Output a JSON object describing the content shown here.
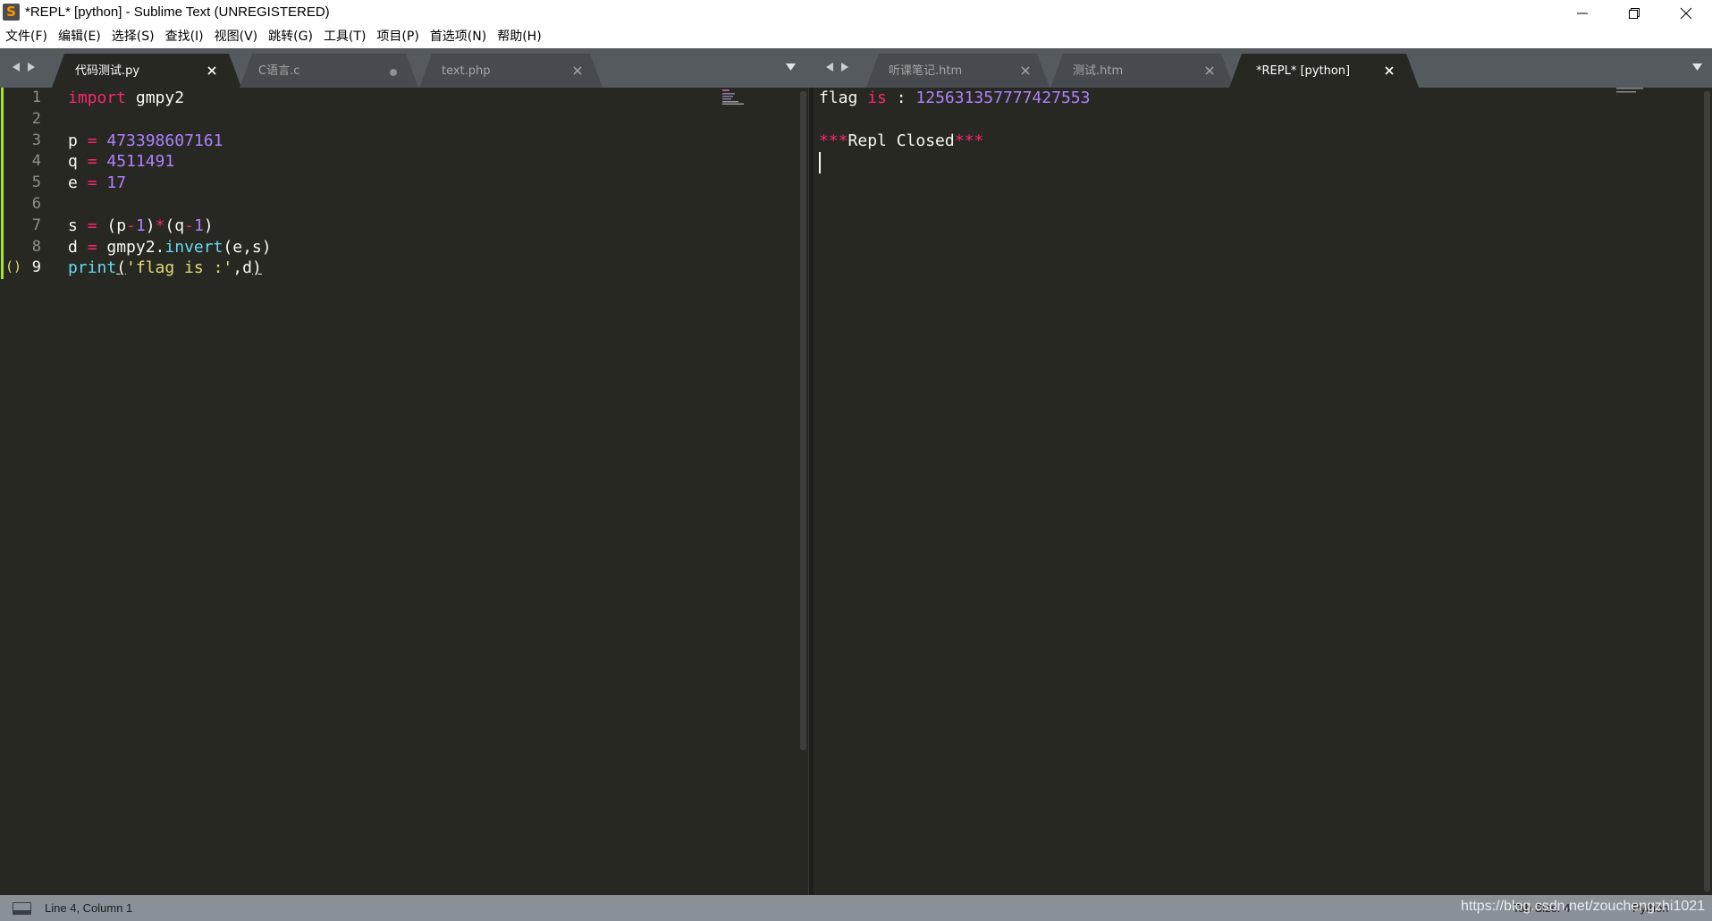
{
  "window": {
    "title": "*REPL* [python] - Sublime Text (UNREGISTERED)",
    "app_icon": "S"
  },
  "menu": {
    "items": [
      "文件(F)",
      "编辑(E)",
      "选择(S)",
      "查找(I)",
      "视图(V)",
      "跳转(G)",
      "工具(T)",
      "项目(P)",
      "首选项(N)",
      "帮助(H)"
    ]
  },
  "left_pane": {
    "tabs": [
      {
        "label": "代码测试.py",
        "active": true,
        "indicator": "close"
      },
      {
        "label": "C语言.c",
        "active": false,
        "indicator": "dirty-dot"
      },
      {
        "label": "text.php",
        "active": false,
        "indicator": "close"
      }
    ],
    "line_numbers": [
      "1",
      "2",
      "3",
      "4",
      "5",
      "6",
      "7",
      "8",
      "9"
    ],
    "brace_marker": "()",
    "code": {
      "l1": {
        "kw": "import",
        "rest": " gmpy2"
      },
      "l3": {
        "var": "p ",
        "op": "=",
        "num": "473398607161"
      },
      "l4": {
        "var": "q ",
        "op": "=",
        "num": "4511491"
      },
      "l5": {
        "var": "e ",
        "op": "=",
        "num": "17"
      },
      "l7": {
        "a": "s ",
        "op1": "=",
        "b": " (p",
        "op2": "-",
        "n1": "1",
        "c": ")",
        "op3": "*",
        "d": "(q",
        "op4": "-",
        "n2": "1",
        "e": ")"
      },
      "l8": {
        "a": "d ",
        "op": "=",
        "b": " gmpy2.",
        "fn": "invert",
        "c": "(e,s)"
      },
      "l9": {
        "fn": "print",
        "open": "(",
        "str": "'flag is :'",
        "rest": ",d",
        "close": ")"
      }
    }
  },
  "right_pane": {
    "tabs": [
      {
        "label": "听课笔记.htm",
        "active": false,
        "indicator": "close"
      },
      {
        "label": "测试.htm",
        "active": false,
        "indicator": "close"
      },
      {
        "label": "*REPL* [python]",
        "active": true,
        "indicator": "close"
      }
    ],
    "output": {
      "l1": {
        "a": "flag ",
        "kw": "is",
        "b": " : ",
        "num": "125631357777427553"
      },
      "l3": {
        "stars1": "***",
        "text": "Repl Closed",
        "stars2": "***"
      }
    }
  },
  "status": {
    "position": "Line 4, Column 1",
    "tab_size": "Tab Size: 4",
    "syntax": "Python",
    "watermark": "https://blog.csdn.net/zouchengzhi1021"
  },
  "colors": {
    "background": "#272822",
    "keyword": "#f92672",
    "number": "#ae81ff",
    "function": "#66d9ef",
    "string": "#e6db74",
    "tabbar": "#555a5e",
    "statusbar": "#8a9196"
  }
}
